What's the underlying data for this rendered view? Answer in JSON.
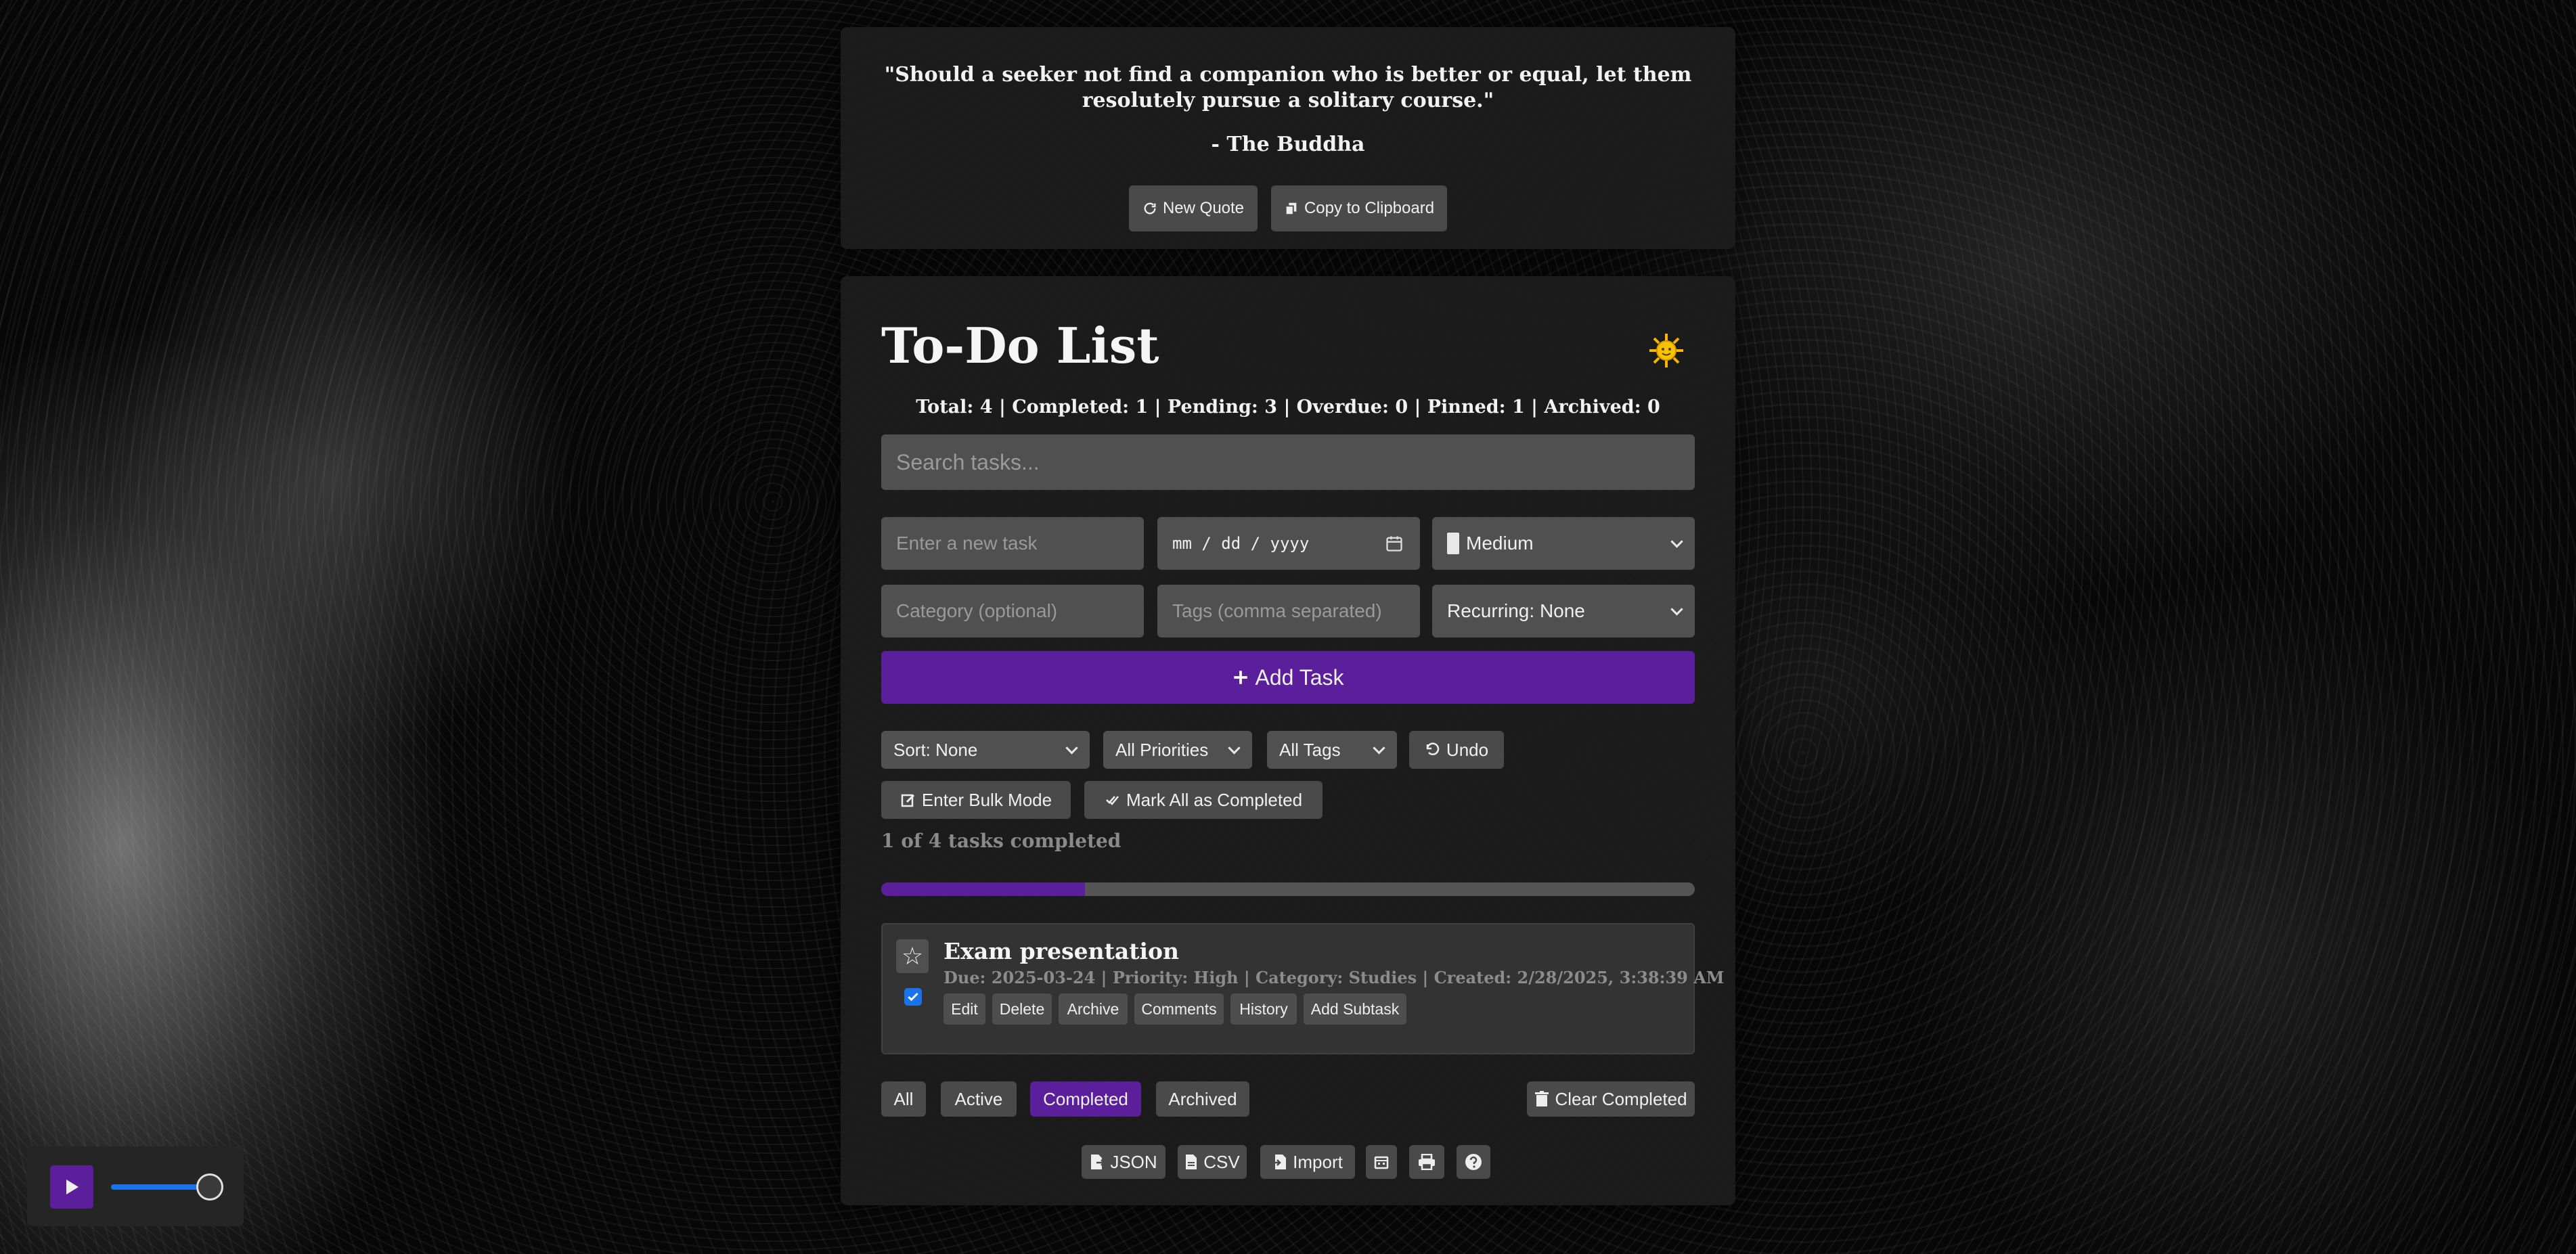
{
  "quote": {
    "text": "\"Should a seeker not find a companion who is better or equal, let them resolutely pursue a solitary course.\"",
    "author": "- The Buddha",
    "new_quote_label": "New Quote",
    "copy_label": "Copy to Clipboard"
  },
  "todo": {
    "title": "To-Do List",
    "theme_icon": "sun-icon",
    "stats": "Total: 4 | Completed: 1 | Pending: 3 | Overdue: 0 | Pinned: 1 | Archived: 0",
    "search_placeholder": "Search tasks...",
    "form": {
      "task_placeholder": "Enter a new task",
      "date_placeholder": "mm / dd / yyyy",
      "priority_value": "Medium",
      "category_placeholder": "Category (optional)",
      "tags_placeholder": "Tags (comma separated)",
      "recurring_value": "Recurring: None",
      "add_label": "Add Task"
    },
    "toolbar": {
      "sort_value": "Sort: None",
      "priority_filter_value": "All Priorities",
      "tags_filter_value": "All Tags",
      "undo_label": "Undo",
      "bulk_label": "Enter Bulk Mode",
      "mark_all_label": "Mark All as Completed"
    },
    "progress": {
      "label": "1 of 4 tasks completed",
      "fraction": 0.25
    },
    "tasks": [
      {
        "title": "Exam presentation",
        "meta": "Due: 2025-03-24 | Priority: High | Category: Studies | Created: 2/28/2025, 3:38:39 AM",
        "completed": true,
        "actions": [
          "Edit",
          "Delete",
          "Archive",
          "Comments",
          "History",
          "Add Subtask"
        ]
      }
    ],
    "filters": {
      "all": "All",
      "active": "Active",
      "completed": "Completed",
      "archived": "Archived",
      "clear_completed": "Clear Completed"
    },
    "footer": {
      "json": "JSON",
      "csv": "CSV",
      "import": "Import"
    }
  },
  "colors": {
    "accent": "#5b1f9b",
    "checkbox": "#1a73e8"
  },
  "player": {
    "volume": 1.0
  }
}
